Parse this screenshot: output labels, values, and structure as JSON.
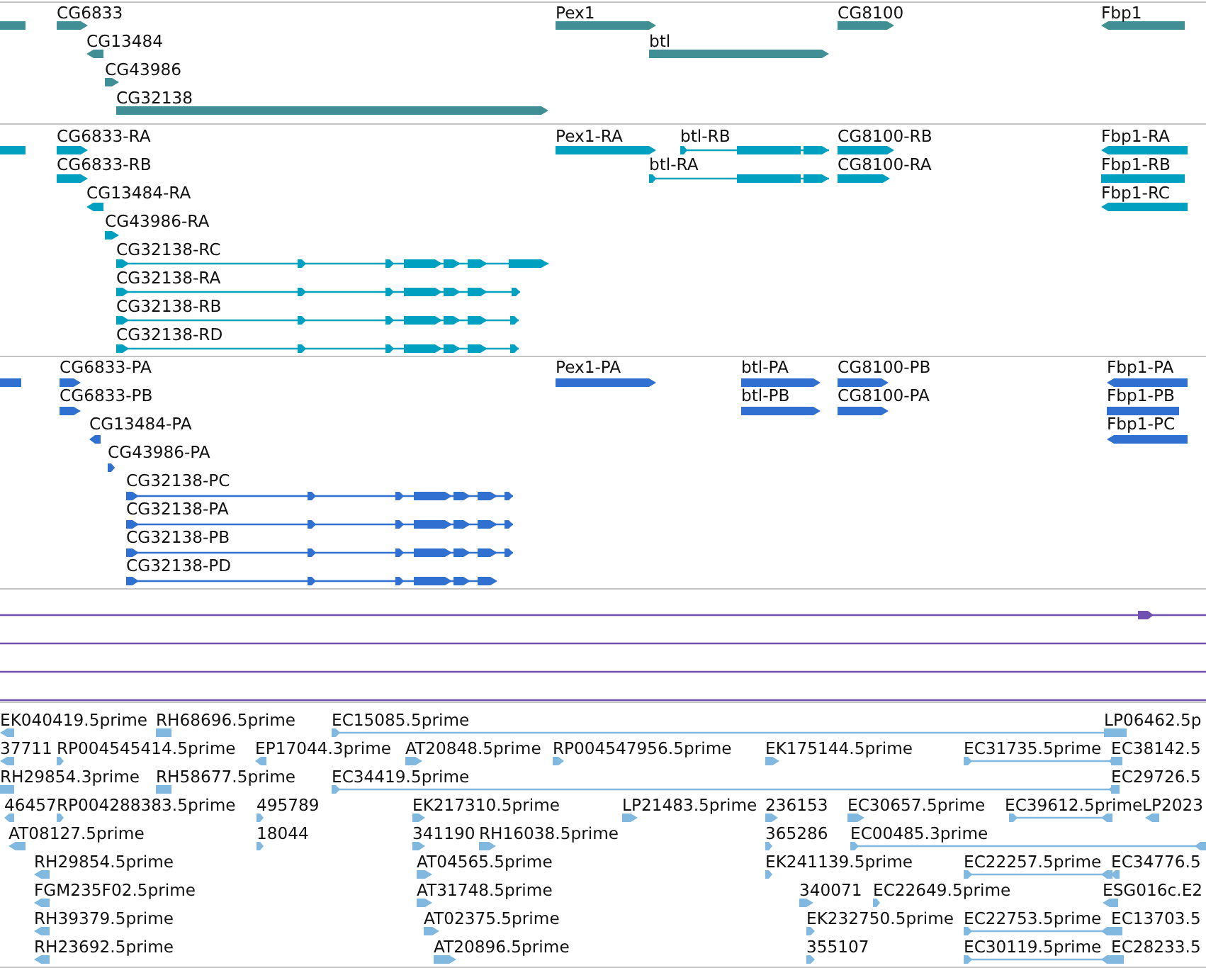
{
  "tracks": [
    {
      "color": "#408f94",
      "features": [
        {
          "label": "CG6833"
        },
        {
          "label": "CG13484"
        },
        {
          "label": "CG43986"
        },
        {
          "label": "CG32138"
        },
        {
          "label": "Pex1"
        },
        {
          "label": "btl"
        },
        {
          "label": "CG8100"
        },
        {
          "label": "Fbp1"
        }
      ]
    },
    {
      "color": "#00a0c0",
      "features": [
        {
          "label": "CG6833-RA"
        },
        {
          "label": "CG6833-RB"
        },
        {
          "label": "CG13484-RA"
        },
        {
          "label": "CG43986-RA"
        },
        {
          "label": "CG32138-RC"
        },
        {
          "label": "CG32138-RA"
        },
        {
          "label": "CG32138-RB"
        },
        {
          "label": "CG32138-RD"
        },
        {
          "label": "Pex1-RA"
        },
        {
          "label": "btl-RB"
        },
        {
          "label": "btl-RA"
        },
        {
          "label": "CG8100-RB"
        },
        {
          "label": "CG8100-RA"
        },
        {
          "label": "Fbp1-RA"
        },
        {
          "label": "Fbp1-RB"
        },
        {
          "label": "Fbp1-RC"
        }
      ]
    },
    {
      "color": "#3070d0",
      "features": [
        {
          "label": "CG6833-PA"
        },
        {
          "label": "CG6833-PB"
        },
        {
          "label": "CG13484-PA"
        },
        {
          "label": "CG43986-PA"
        },
        {
          "label": "CG32138-PC"
        },
        {
          "label": "CG32138-PA"
        },
        {
          "label": "CG32138-PB"
        },
        {
          "label": "CG32138-PD"
        },
        {
          "label": "Pex1-PA"
        },
        {
          "label": "btl-PA"
        },
        {
          "label": "btl-PB"
        },
        {
          "label": "CG8100-PB"
        },
        {
          "label": "CG8100-PA"
        },
        {
          "label": "Fbp1-PA"
        },
        {
          "label": "Fbp1-PB"
        },
        {
          "label": "Fbp1-PC"
        }
      ]
    },
    {
      "color": "#7050b0"
    },
    {
      "color": "#80b8e0",
      "features": [
        {
          "label": "EK040419.5prime"
        },
        {
          "label": "RH68696.5prime"
        },
        {
          "label": "EC15085.5prime"
        },
        {
          "label": "LP06462.5p"
        },
        {
          "label": "37711"
        },
        {
          "label": "RP004545414.5prime"
        },
        {
          "label": "EP17044.3prime"
        },
        {
          "label": "AT20848.5prime"
        },
        {
          "label": "RP004547956.5prime"
        },
        {
          "label": "EK175144.5prime"
        },
        {
          "label": "EC31735.5prime"
        },
        {
          "label": "EC38142.5"
        },
        {
          "label": "RH29854.3prime"
        },
        {
          "label": "RH58677.5prime"
        },
        {
          "label": "EC34419.5prime"
        },
        {
          "label": "EC29726.5"
        },
        {
          "label": "46457"
        },
        {
          "label": "RP004288383.5prime"
        },
        {
          "label": "495789"
        },
        {
          "label": "EK217310.5prime"
        },
        {
          "label": "LP21483.5prime"
        },
        {
          "label": "236153"
        },
        {
          "label": "EC30657.5prime"
        },
        {
          "label": "EC39612.5prime"
        },
        {
          "label": "LP2023"
        },
        {
          "label": "AT08127.5prime"
        },
        {
          "label": "18044"
        },
        {
          "label": "341190"
        },
        {
          "label": "RH16038.5prime"
        },
        {
          "label": "365286"
        },
        {
          "label": "EC00485.3prime"
        },
        {
          "label": "RH29854.5prime"
        },
        {
          "label": "AT04565.5prime"
        },
        {
          "label": "EK241139.5prime"
        },
        {
          "label": "EC22257.5prime"
        },
        {
          "label": "EC34776.5"
        },
        {
          "label": "FGM235F02.5prime"
        },
        {
          "label": "AT31748.5prime"
        },
        {
          "label": "340071"
        },
        {
          "label": "EC22649.5prime"
        },
        {
          "label": "ESG016c.E2"
        },
        {
          "label": "RH39379.5prime"
        },
        {
          "label": "AT02375.5prime"
        },
        {
          "label": "EK232750.5prime"
        },
        {
          "label": "EC22753.5prime"
        },
        {
          "label": "EC13703.5"
        },
        {
          "label": "RH23692.5prime"
        },
        {
          "label": "AT20896.5prime"
        },
        {
          "label": "355107"
        },
        {
          "label": "EC30119.5prime"
        },
        {
          "label": "EC28233.5"
        }
      ]
    }
  ]
}
